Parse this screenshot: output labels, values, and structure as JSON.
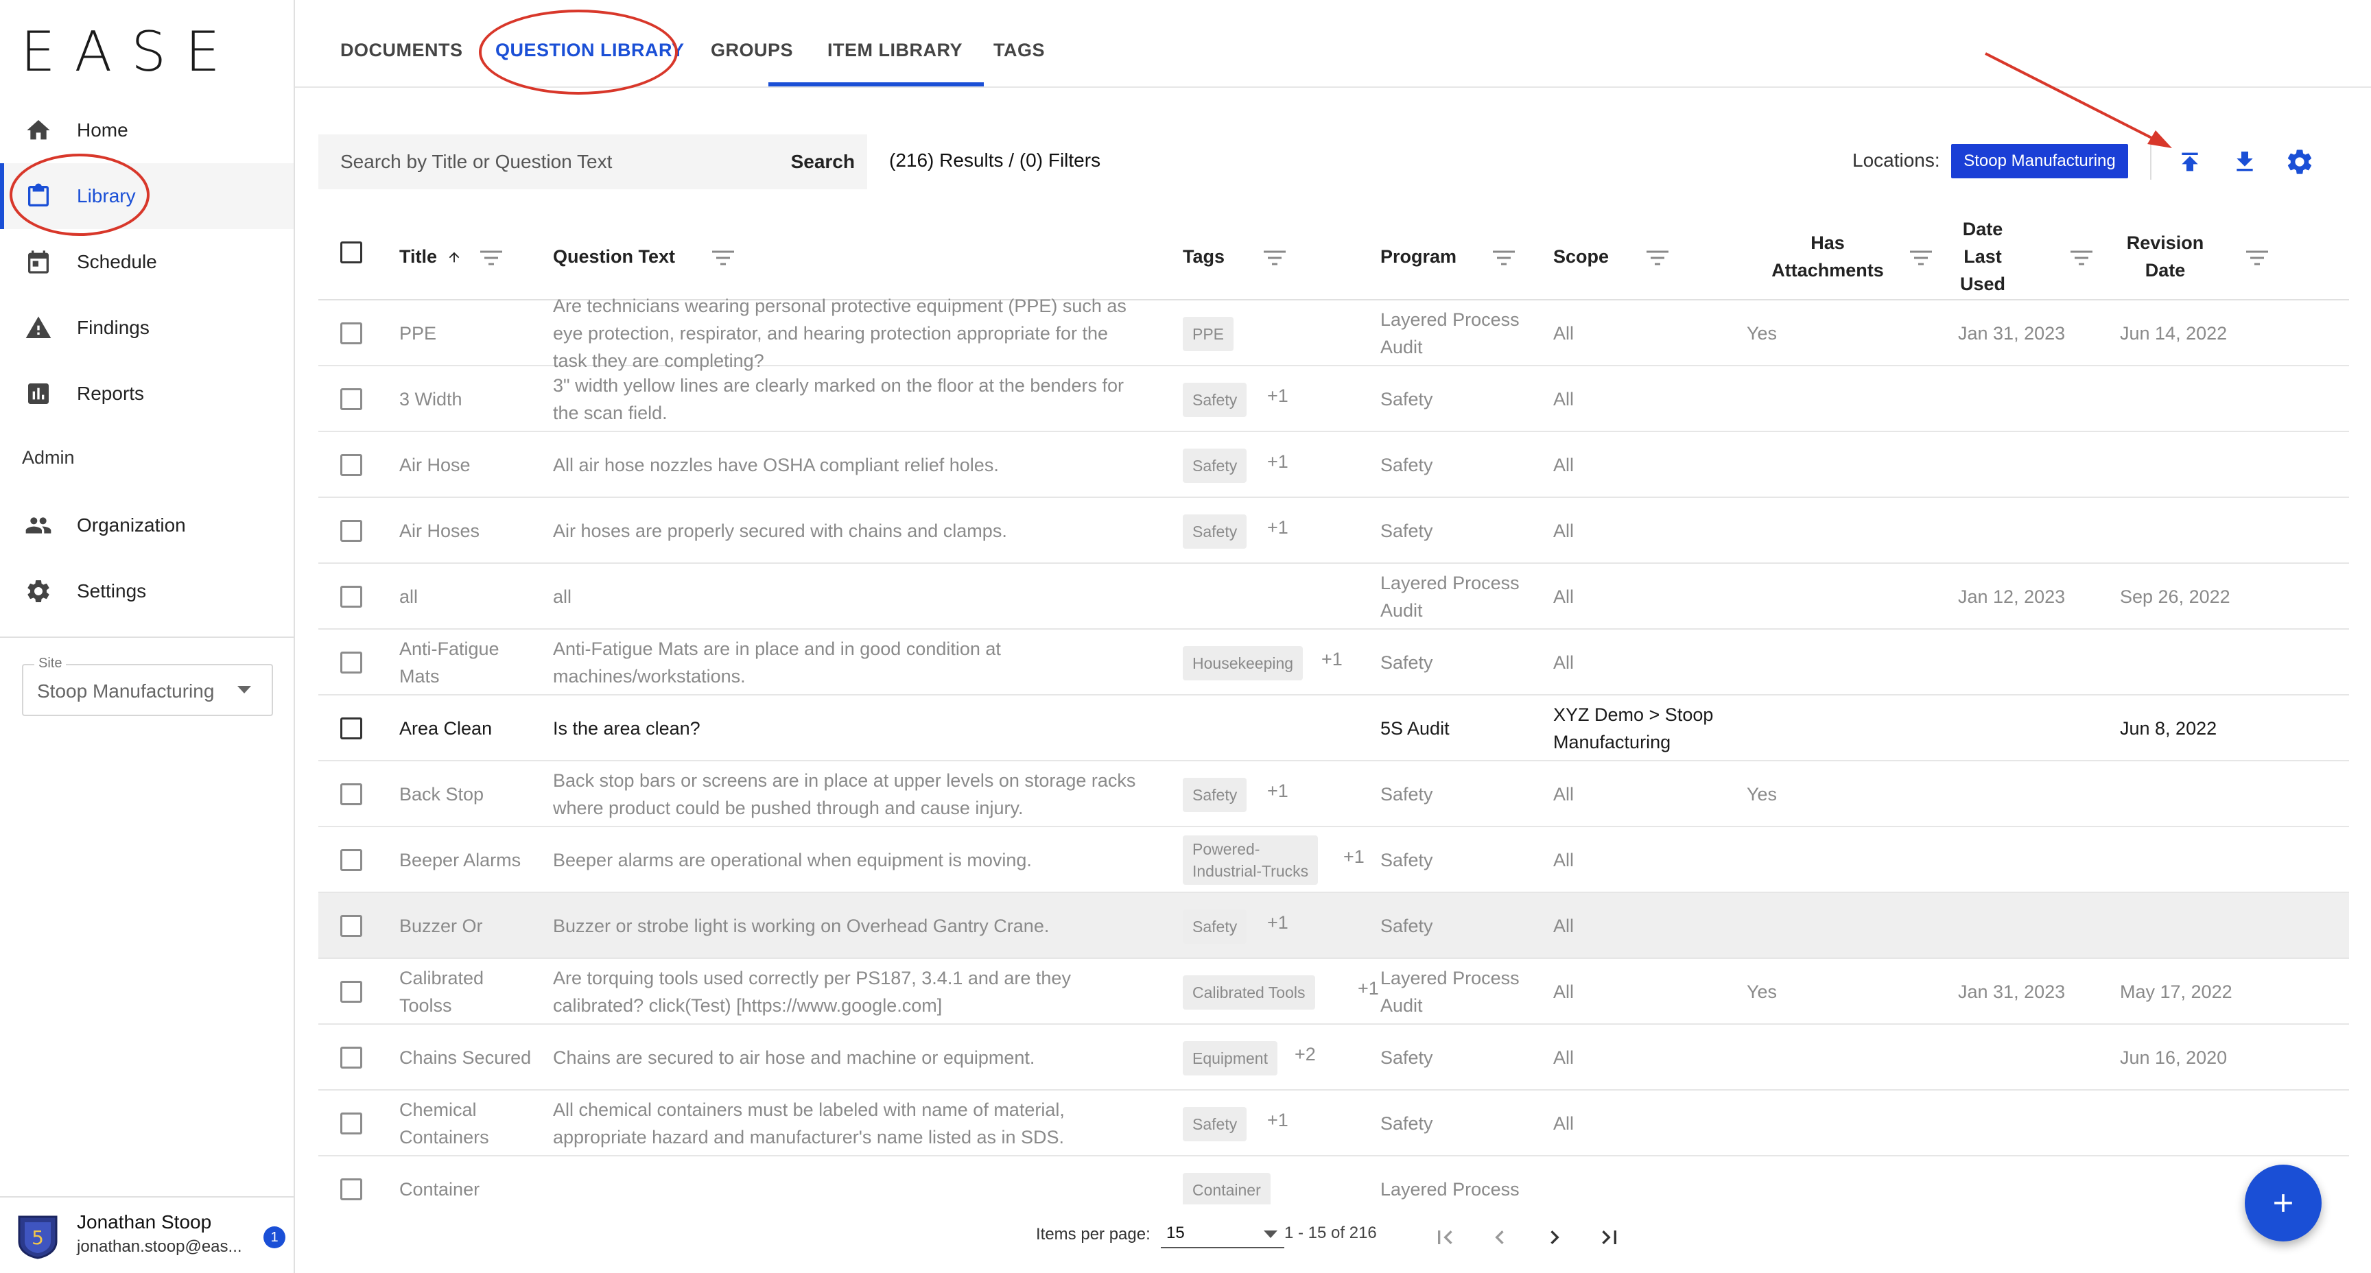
{
  "app": {
    "logo": "EASE"
  },
  "sidebar": {
    "items": [
      {
        "label": "Home",
        "icon": "home-icon"
      },
      {
        "label": "Library",
        "icon": "clipboard-icon",
        "active": true
      },
      {
        "label": "Schedule",
        "icon": "calendar-icon"
      },
      {
        "label": "Findings",
        "icon": "warning-icon"
      },
      {
        "label": "Reports",
        "icon": "bar-chart-icon"
      }
    ],
    "admin_label": "Admin",
    "admin_items": [
      {
        "label": "Organization",
        "icon": "people-icon"
      },
      {
        "label": "Settings",
        "icon": "gear-icon"
      }
    ],
    "site": {
      "label": "Site",
      "value": "Stoop Manufacturing"
    },
    "user": {
      "name": "Jonathan Stoop",
      "email": "jonathan.stoop@eas...",
      "avatar_text": "5",
      "notification_count": "1"
    }
  },
  "tabs": [
    "DOCUMENTS",
    "QUESTION LIBRARY",
    "GROUPS",
    "ITEM LIBRARY",
    "TAGS"
  ],
  "active_tab": "QUESTION LIBRARY",
  "toolbar": {
    "search_placeholder": "Search by Title or Question Text",
    "search_button": "Search",
    "results_text": "(216) Results / (0) Filters",
    "locations_label": "Locations:",
    "location_chip": "Stoop Manufacturing",
    "actions": [
      "upload-icon",
      "download-icon",
      "gear-icon"
    ]
  },
  "table": {
    "headers": {
      "title": "Title",
      "question": "Question Text",
      "tags": "Tags",
      "program": "Program",
      "scope": "Scope",
      "attach_1": "Has",
      "attach_2": "Attachments",
      "last_1": "Date",
      "last_2": "Last",
      "last_3": "Used",
      "rev_1": "Revision",
      "rev_2": "Date"
    },
    "rows": [
      {
        "title": [
          "PPE"
        ],
        "question": [
          "Are technicians wearing personal protective equipment (PPE) such as",
          "eye protection, respirator, and hearing protection appropriate for the",
          "task they are completing?"
        ],
        "tag": "PPE",
        "more": "",
        "program": [
          "Layered Process",
          "Audit"
        ],
        "scope": [
          "All"
        ],
        "attach": "Yes",
        "last": "Jan 31, 2023",
        "rev": "Jun 14, 2022"
      },
      {
        "title": [
          "3 Width"
        ],
        "question": [
          "3\" width yellow lines are clearly marked on the floor at the benders for",
          "the scan field."
        ],
        "tag": "Safety",
        "more": "+1",
        "program": [
          "Safety"
        ],
        "scope": [
          "All"
        ],
        "attach": "",
        "last": "",
        "rev": ""
      },
      {
        "title": [
          "Air Hose"
        ],
        "question": [
          "All air hose nozzles have OSHA compliant relief holes."
        ],
        "tag": "Safety",
        "more": "+1",
        "program": [
          "Safety"
        ],
        "scope": [
          "All"
        ],
        "attach": "",
        "last": "",
        "rev": ""
      },
      {
        "title": [
          "Air Hoses"
        ],
        "question": [
          "Air hoses are properly secured with chains and clamps."
        ],
        "tag": "Safety",
        "more": "+1",
        "program": [
          "Safety"
        ],
        "scope": [
          "All"
        ],
        "attach": "",
        "last": "",
        "rev": ""
      },
      {
        "title": [
          "all"
        ],
        "question": [
          "all"
        ],
        "tag": "",
        "more": "",
        "program": [
          "Layered Process",
          "Audit"
        ],
        "scope": [
          "All"
        ],
        "attach": "",
        "last": "Jan 12, 2023",
        "rev": "Sep 26, 2022"
      },
      {
        "title": [
          "Anti-Fatigue",
          "Mats"
        ],
        "question": [
          "Anti-Fatigue Mats are in place and in good condition at",
          "machines/workstations."
        ],
        "tag": "Housekeeping",
        "more": "+1",
        "program": [
          "Safety"
        ],
        "scope": [
          "All"
        ],
        "attach": "",
        "last": "",
        "rev": ""
      },
      {
        "title": [
          "Area Clean"
        ],
        "question": [
          "Is the area clean?"
        ],
        "tag": "",
        "more": "",
        "program": [
          "5S Audit"
        ],
        "scope": [
          "XYZ Demo > Stoop",
          "Manufacturing"
        ],
        "attach": "",
        "last": "",
        "rev": "Jun 8, 2022",
        "dark": true
      },
      {
        "title": [
          "Back Stop"
        ],
        "question": [
          "Back stop bars or screens are in place at upper levels on storage racks",
          "where product could be pushed through and cause injury."
        ],
        "tag": "Safety",
        "more": "+1",
        "program": [
          "Safety"
        ],
        "scope": [
          "All"
        ],
        "attach": "Yes",
        "last": "",
        "rev": ""
      },
      {
        "title": [
          "Beeper Alarms"
        ],
        "question": [
          "Beeper alarms are operational when equipment is moving."
        ],
        "tag": "Powered-\nIndustrial-Trucks",
        "more": "+1",
        "program": [
          "Safety"
        ],
        "scope": [
          "All"
        ],
        "attach": "",
        "last": "",
        "rev": ""
      },
      {
        "title": [
          "Buzzer Or"
        ],
        "question": [
          "Buzzer or strobe light is working on Overhead Gantry Crane."
        ],
        "tag": "Safety",
        "more": "+1",
        "program": [
          "Safety"
        ],
        "scope": [
          "All"
        ],
        "attach": "",
        "last": "",
        "rev": "",
        "hl": true
      },
      {
        "title": [
          "Calibrated",
          "Toolss"
        ],
        "question": [
          "Are torquing tools used correctly per PS187, 3.4.1 and are they",
          "calibrated? click(Test) [https://www.google.com]"
        ],
        "tag": "Calibrated Tools",
        "more": "+1",
        "program": [
          "Layered Process",
          "Audit"
        ],
        "scope": [
          "All"
        ],
        "attach": "Yes",
        "last": "Jan 31, 2023",
        "rev": "May 17, 2022"
      },
      {
        "title": [
          "Chains Secured"
        ],
        "question": [
          "Chains are secured to air hose and machine or equipment."
        ],
        "tag": "Equipment",
        "more": "+2",
        "program": [
          "Safety"
        ],
        "scope": [
          "All"
        ],
        "attach": "",
        "last": "",
        "rev": "Jun 16, 2020"
      },
      {
        "title": [
          "Chemical",
          "Containers"
        ],
        "question": [
          "All chemical containers must be labeled with name of material,",
          "appropriate hazard and manufacturer's name listed as in SDS."
        ],
        "tag": "Safety",
        "more": "+1",
        "program": [
          "Safety"
        ],
        "scope": [
          "All"
        ],
        "attach": "",
        "last": "",
        "rev": ""
      },
      {
        "title": [
          "Container"
        ],
        "question": [
          ""
        ],
        "tag": "Container",
        "more": "",
        "program": [
          "Layered Process"
        ],
        "scope": [
          ""
        ],
        "attach": "",
        "last": "",
        "rev": ""
      }
    ]
  },
  "paginator": {
    "items_label": "Items per page:",
    "page_size": "15",
    "range": "1 - 15 of 216"
  },
  "colors": {
    "accent": "#1a4fd6",
    "annotation": "#d8372a"
  }
}
